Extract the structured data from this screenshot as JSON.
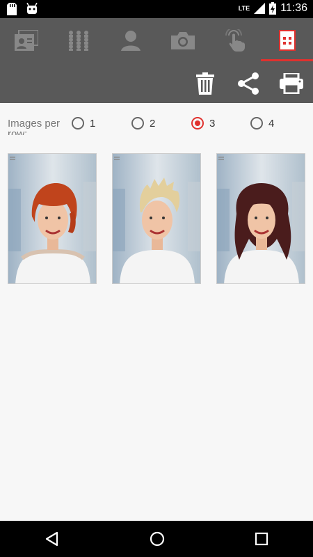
{
  "status": {
    "network": "LTE",
    "time": "11:36"
  },
  "tabs": [
    {
      "icon": "id-card-icon",
      "selected": false
    },
    {
      "icon": "people-grid-icon",
      "selected": false
    },
    {
      "icon": "person-icon",
      "selected": false
    },
    {
      "icon": "camera-icon",
      "selected": false
    },
    {
      "icon": "touch-icon",
      "selected": false
    },
    {
      "icon": "grid-view-icon",
      "selected": true
    }
  ],
  "actions": [
    {
      "icon": "trash-icon"
    },
    {
      "icon": "share-icon"
    },
    {
      "icon": "print-icon"
    }
  ],
  "images_per_row": {
    "label": "Images per row:",
    "options": [
      "1",
      "2",
      "3",
      "4"
    ],
    "selected": "3"
  },
  "colors": {
    "accent": "#e0312e",
    "toolbar": "#595959"
  }
}
